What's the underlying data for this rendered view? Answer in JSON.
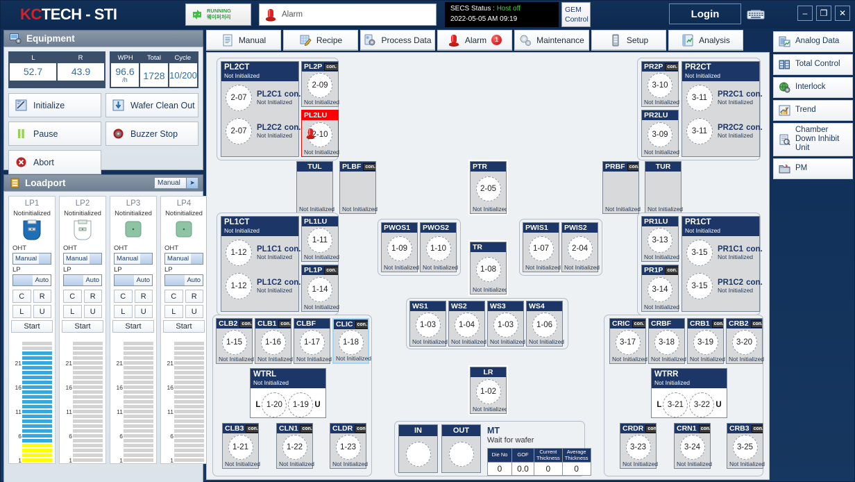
{
  "titlebar": {
    "logo_kc": "KC",
    "logo_tech": "TECH",
    "logo_dash": "-",
    "logo_sti": "STI",
    "run_line1": "RUNNING",
    "run_line2": "웨이퍼처리",
    "alarm_placeholder": "Alarm",
    "secs_line1_label": "SECS Status : ",
    "secs_line1_value": "Host off",
    "secs_line2": "2022-05-05 AM 09:19",
    "gem_line1": "GEM",
    "gem_line2": "Control",
    "login_label": "Login",
    "minimize": "–",
    "maximize": "❐",
    "close": "✕"
  },
  "equipment": {
    "title": "Equipment",
    "lr": {
      "headers": [
        "L",
        "R"
      ],
      "values": [
        "52.7",
        "43.9"
      ]
    },
    "wph": {
      "headers": [
        "WPH",
        "Total",
        "Cycle"
      ],
      "values": [
        "96.6",
        "1728",
        "10/200"
      ],
      "wph_unit": "/h"
    },
    "buttons": [
      {
        "label": "Initialize",
        "icon": "initialize-icon"
      },
      {
        "label": "Wafer Clean Out",
        "icon": "wafer-clean-out-icon"
      },
      {
        "label": "Pause",
        "icon": "pause-icon"
      },
      {
        "label": "Buzzer Stop",
        "icon": "buzzer-stop-icon"
      },
      {
        "label": "Abort",
        "icon": "abort-icon"
      }
    ]
  },
  "loadport": {
    "title": "Loadport",
    "mode_selector": "Manual",
    "slot_labels": [
      "21",
      "16",
      "11",
      "6",
      "1"
    ],
    "ports": [
      {
        "name": "LP1",
        "status": "Notinitialized",
        "carrier": "filled-blue",
        "oht_label": "OHT",
        "oht_mode": "Manual",
        "lp_label": "LP",
        "lp_mode": "Auto",
        "keys": [
          "C",
          "R",
          "L",
          "U"
        ],
        "start": "Start",
        "blue_slots": 19,
        "yellow_slots": 4
      },
      {
        "name": "LP2",
        "status": "Notinitialized",
        "carrier": "empty",
        "oht_label": "OHT",
        "oht_mode": "Manual",
        "lp_label": "LP",
        "lp_mode": "Auto",
        "keys": [
          "C",
          "R",
          "L",
          "U"
        ],
        "start": "Start",
        "blue_slots": 0,
        "yellow_slots": 0
      },
      {
        "name": "LP3",
        "status": "Notinitialized",
        "carrier": "green",
        "oht_label": "OHT",
        "oht_mode": "Manual",
        "lp_label": "LP",
        "lp_mode": "Auto",
        "keys": [
          "C",
          "R",
          "L",
          "U"
        ],
        "start": "Start",
        "blue_slots": 0,
        "yellow_slots": 0
      },
      {
        "name": "LP4",
        "status": "Notinitialized",
        "carrier": "green",
        "oht_label": "OHT",
        "oht_mode": "Manual",
        "lp_label": "LP",
        "lp_mode": "Auto",
        "keys": [
          "C",
          "R",
          "L",
          "U"
        ],
        "start": "Start",
        "blue_slots": 0,
        "yellow_slots": 0
      }
    ]
  },
  "tabs": [
    {
      "label": "Manual",
      "icon": "document-icon"
    },
    {
      "label": "Recipe",
      "icon": "recipe-pencil-icon"
    },
    {
      "label": "Process Data",
      "icon": "process-gear-icon"
    },
    {
      "label": "Alarm",
      "icon": "alarm-lamp-icon",
      "badge": "1"
    },
    {
      "label": "Maintenance",
      "icon": "gears-icon"
    },
    {
      "label": "Setup",
      "icon": "server-icon"
    },
    {
      "label": "Analysis",
      "icon": "chart-icon"
    }
  ],
  "sidebar": [
    {
      "label": "Analog Data",
      "icon": "analog-data-icon"
    },
    {
      "label": "Total Control",
      "icon": "total-control-icon"
    },
    {
      "label": "Interlock",
      "icon": "interlock-globe-icon"
    },
    {
      "label": "Trend",
      "icon": "trend-chart-icon"
    },
    {
      "label": "Chamber Down Inhibit Unit",
      "icon": "chamber-down-icon"
    },
    {
      "label": "PM",
      "icon": "pm-folder-icon"
    }
  ],
  "status_text": "Not Initialized",
  "con_badge": "con.",
  "modules": {
    "pl2ct": {
      "name": "PL2CT",
      "status": "Not Initialized",
      "rows": [
        {
          "circ": "2-07",
          "name": "PL2C1",
          "status": "Not Initialized",
          "con": true
        },
        {
          "circ": "2-07",
          "name": "PL2C2",
          "status": "Not Initialized",
          "con": true
        }
      ]
    },
    "pl2p": {
      "name": "PL2P",
      "circ": "2-09",
      "status": "Not Initialized",
      "con": true
    },
    "pl2lu": {
      "name": "PL2LU",
      "circ": "2-10",
      "status": "Not Initialized",
      "alarm": true
    },
    "pr2ct": {
      "name": "PR2CT",
      "status": "Not Initialized",
      "rows": [
        {
          "circ": "3-11",
          "name": "PR2C1",
          "status": "Not Initialized",
          "con": true
        },
        {
          "circ": "3-11",
          "name": "PR2C2",
          "status": "Not Initialized",
          "con": true
        }
      ]
    },
    "pr2p": {
      "name": "PR2P",
      "circ": "3-10",
      "status": "Not Initialized",
      "con": true
    },
    "pr2lu": {
      "name": "PR2LU",
      "circ": "3-09",
      "status": "Not Initialized"
    },
    "pl1ct": {
      "name": "PL1CT",
      "status": "Not Initialized",
      "rows": [
        {
          "circ": "1-12",
          "name": "PL1C1",
          "status": "Not Initialized",
          "con": true
        },
        {
          "circ": "1-12",
          "name": "PL1C2",
          "status": "Not Initialized",
          "con": true
        }
      ]
    },
    "pl1lu": {
      "name": "PL1LU",
      "circ": "1-11",
      "status": "Not Initialized"
    },
    "pl1p": {
      "name": "PL1P",
      "circ": "1-14",
      "status": "Not Initialized",
      "con": true
    },
    "pr1ct": {
      "name": "PR1CT",
      "status": "Not Initialized",
      "rows": [
        {
          "circ": "3-15",
          "name": "PR1C1",
          "status": "Not Initialized",
          "con": true
        },
        {
          "circ": "3-15",
          "name": "PR1C2",
          "status": "Not Initialized",
          "con": true
        }
      ]
    },
    "pr1lu": {
      "name": "PR1LU",
      "circ": "3-13",
      "status": "Not Initialized"
    },
    "pr1p": {
      "name": "PR1P",
      "circ": "3-14",
      "status": "Not Initialized",
      "con": true
    },
    "tul": {
      "name": "TUL",
      "circ": "",
      "status": "Not Initialized",
      "center_title": true
    },
    "plbf": {
      "name": "PLBF",
      "circ": "",
      "status": "Not Initialized",
      "con": true
    },
    "ptr": {
      "name": "PTR",
      "circ": "2-05",
      "status": "Not Initialized",
      "selected": true
    },
    "prbf": {
      "name": "PRBF",
      "circ": "",
      "status": "Not Initialized",
      "con": true
    },
    "tur": {
      "name": "TUR",
      "circ": "",
      "status": "Not Initialized",
      "center_title": true
    },
    "pwos1": {
      "name": "PWOS1",
      "circ": "1-09",
      "status": "Not Initialized"
    },
    "pwos2": {
      "name": "PWOS2",
      "circ": "1-10",
      "status": "Not Initialized"
    },
    "tr": {
      "name": "TR",
      "circ": "1-08",
      "status": "Not Initialized",
      "selected": true
    },
    "pwis1": {
      "name": "PWIS1",
      "circ": "1-07",
      "status": "Not Initialized"
    },
    "pwis2": {
      "name": "PWIS2",
      "circ": "2-04",
      "status": "Not Initialized"
    },
    "ws1": {
      "name": "WS1",
      "circ": "1-03",
      "status": "Not Initialized"
    },
    "ws2": {
      "name": "WS2",
      "circ": "1-04",
      "status": "Not Initialized"
    },
    "ws3": {
      "name": "WS3",
      "circ": "1-03",
      "status": "Not Initialized"
    },
    "ws4": {
      "name": "WS4",
      "circ": "1-06",
      "status": "Not Initialized"
    },
    "clb2": {
      "name": "CLB2",
      "circ": "1-15",
      "status": "Not Initialized",
      "con": true
    },
    "clb1": {
      "name": "CLB1",
      "circ": "1-16",
      "status": "Not Initialized",
      "con": true
    },
    "clbf": {
      "name": "CLBF",
      "circ": "1-17",
      "status": "Not Initialized"
    },
    "clic": {
      "name": "CLIC",
      "circ": "1-18",
      "status": "Not Initialized",
      "con": true,
      "highlight": true
    },
    "wtrl": {
      "name": "WTRL",
      "status": "Not Initialized",
      "left_key": "L",
      "circ1": "1-20",
      "circ2": "1-19",
      "right_key": "U"
    },
    "clb3": {
      "name": "CLB3",
      "circ": "1-21",
      "status": "Not Initialized",
      "con": true
    },
    "cln1": {
      "name": "CLN1",
      "circ": "1-22",
      "status": "Not Initialized",
      "con": true
    },
    "cldr": {
      "name": "CLDR",
      "circ": "1-23",
      "status": "Not Initialized",
      "con": true
    },
    "cric": {
      "name": "CRIC",
      "circ": "3-17",
      "status": "Not Initialized",
      "con": true
    },
    "crbf": {
      "name": "CRBF",
      "circ": "3-18",
      "status": "Not Initialized"
    },
    "crb1": {
      "name": "CRB1",
      "circ": "3-19",
      "status": "Not Initialized",
      "con": true
    },
    "crb2": {
      "name": "CRB2",
      "circ": "3-20",
      "status": "Not Initialized",
      "con": true
    },
    "wtrr": {
      "name": "WTRR",
      "status": "Not Initialized",
      "left_key": "L",
      "circ1": "3-21",
      "circ2": "3-22",
      "right_key": "U"
    },
    "crdr": {
      "name": "CRDR",
      "circ": "3-23",
      "status": "Not Initialized",
      "con": true
    },
    "crn1": {
      "name": "CRN1",
      "circ": "3-24",
      "status": "Not Initialized",
      "con": true
    },
    "crb3": {
      "name": "CRB3",
      "circ": "3-25",
      "status": "Not Initialized",
      "con": true
    },
    "lr": {
      "name": "LR",
      "circ": "1-02",
      "status": "Not Initialized",
      "selected": true
    }
  },
  "mt_panel": {
    "in_label": "IN",
    "out_label": "OUT",
    "title": "MT",
    "subtitle": "Wait for wafer",
    "columns": [
      "Die No",
      "GOF",
      "Current Thickness",
      "Average Thickness"
    ],
    "values": [
      "0",
      "0.0",
      "0",
      "0"
    ]
  },
  "colors": {
    "header_navy": "#1c3667",
    "alarm_red": "#ff0000",
    "accent_blue": "#34a8e0",
    "slot_yellow": "#ffff00",
    "brand_red": "#d81f26",
    "running_green": "#2f9e3f"
  }
}
